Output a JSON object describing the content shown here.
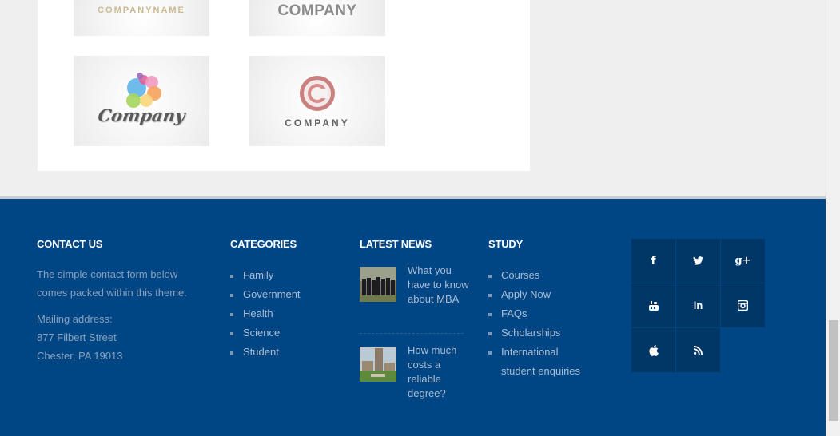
{
  "logos": [
    {
      "caption": "COMPANYNAME"
    },
    {
      "caption": "COMPANY"
    },
    {
      "caption": "Company"
    },
    {
      "caption": "COMPANY"
    }
  ],
  "footer": {
    "contact": {
      "title": "CONTACT US",
      "text_line1": "The simple contact form below",
      "text_line2": "comes packed within this theme.",
      "mail_label": "Mailing address:",
      "street": "877 Filbert Street",
      "city": "Chester, PA 19013"
    },
    "categories": {
      "title": "CATEGORIES",
      "items": [
        "Family",
        "Government",
        "Health",
        "Science",
        "Student"
      ]
    },
    "news": {
      "title": "LATEST NEWS",
      "items": [
        {
          "title": "What you have to know about MBA"
        },
        {
          "title": "How much costs a reliable degree?"
        }
      ]
    },
    "study": {
      "title": "STUDY",
      "items": [
        "Courses",
        "Apply Now",
        "FAQs",
        "Scholarships",
        "International",
        "student enquiries"
      ]
    },
    "social": [
      {
        "icon": "facebook-icon",
        "glyph": "f"
      },
      {
        "icon": "twitter-icon",
        "glyph": ""
      },
      {
        "icon": "google-plus-icon",
        "glyph": "g+"
      },
      {
        "icon": "youtube-icon",
        "glyph": ""
      },
      {
        "icon": "linkedin-icon",
        "glyph": "in"
      },
      {
        "icon": "instagram-icon",
        "glyph": ""
      },
      {
        "icon": "apple-icon",
        "glyph": ""
      },
      {
        "icon": "rss-icon",
        "glyph": ""
      }
    ]
  },
  "colors": {
    "footer_bg": "#004684",
    "social_bg": "#013766",
    "page_bg": "#efefef"
  }
}
